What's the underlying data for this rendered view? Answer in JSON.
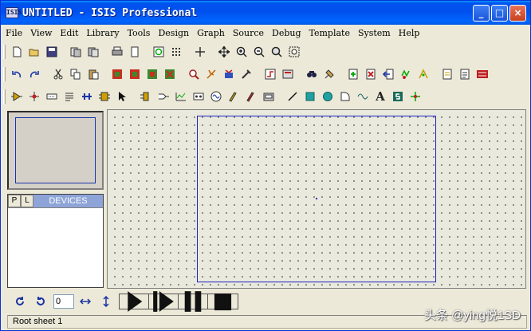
{
  "window": {
    "icon_text": "ISIS",
    "title": "UNTITLED - ISIS Professional",
    "buttons": {
      "minimize": "_",
      "maximize": "□",
      "close": "×"
    }
  },
  "menu": [
    "File",
    "View",
    "Edit",
    "Library",
    "Tools",
    "Design",
    "Graph",
    "Source",
    "Debug",
    "Template",
    "System",
    "Help"
  ],
  "toolbar1": [
    "new-file-icon",
    "open-folder-icon",
    "save-icon",
    "import-icon",
    "export-icon",
    "print-icon",
    "print-preview-icon",
    "redraw-icon",
    "grid-icon",
    "origin-icon",
    "pan-icon",
    "zoom-in-icon",
    "zoom-out-icon",
    "zoom-all-icon",
    "zoom-area-icon"
  ],
  "toolbar2": [
    "undo-icon",
    "redo-icon",
    "cut-icon",
    "copy-icon",
    "paste-icon",
    "block-copy-icon",
    "block-move-icon",
    "block-rotate-icon",
    "block-delete-icon",
    "pick-device-icon",
    "make-device-icon",
    "packaging-icon",
    "decompose-icon",
    "wire-autorouter-icon",
    "property-tool-icon",
    "search-tag-icon",
    "property-assign-icon",
    "new-sheet-icon",
    "remove-sheet-icon",
    "exit-parent-icon",
    "bom-icon",
    "electrical-rules-icon",
    "netlist-icon",
    "ares-icon"
  ],
  "toolbar3": [
    "select-icon",
    "component-icon",
    "junction-dot-icon",
    "wire-label-icon",
    "text-script-icon",
    "bus-icon",
    "subcircuit-icon",
    "terminals-icon",
    "device-pins-icon",
    "graph-icon",
    "tape-icon",
    "generator-icon",
    "voltage-probe-icon",
    "current-probe-icon",
    "virtual-instruments-icon",
    "line-icon",
    "box-icon",
    "circle-icon",
    "arc-icon",
    "path-icon",
    "text-icon",
    "symbol-icon",
    "marker-icon"
  ],
  "toolbar3_text": {
    "text_tool": "A"
  },
  "devices_panel": {
    "p_button": "P",
    "l_button": "L",
    "title": "DEVICES"
  },
  "rotation": {
    "value": "0"
  },
  "simulation": [
    "play-icon",
    "step-icon",
    "pause-icon",
    "stop-icon"
  ],
  "status": {
    "text": "Root sheet 1"
  },
  "watermark": "头条 @ying悦1SD",
  "colors": {
    "titlebar": "#0054e3",
    "sheet_border": "#2020c0",
    "canvas_bg": "#e9e9de",
    "devices_header": "#8ea4d8"
  }
}
